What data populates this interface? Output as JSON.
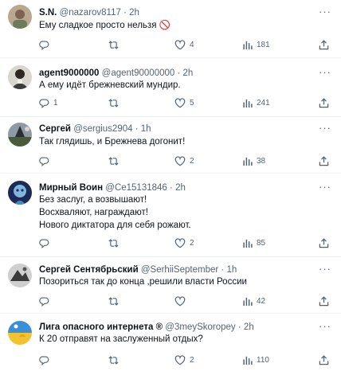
{
  "comments": [
    {
      "name": "S.N.",
      "handle": "@nazarov8117",
      "dot": "·",
      "time": "2h",
      "lines": [
        "Ему сладкое просто нельзя 🚫"
      ],
      "reply_count": "",
      "retweet_count": "",
      "like_count": "4",
      "view_count": "181"
    },
    {
      "name": "agent9000000",
      "handle": "@agent90000000",
      "dot": "·",
      "time": "2h",
      "lines": [
        "А ему идёт брежневский мундир."
      ],
      "reply_count": "1",
      "retweet_count": "",
      "like_count": "5",
      "view_count": "241"
    },
    {
      "name": "Сергей",
      "handle": "@sergius2904",
      "dot": "·",
      "time": "1h",
      "lines": [
        "Так глядишь, и Брежнева догонит!"
      ],
      "reply_count": "",
      "retweet_count": "",
      "like_count": "2",
      "view_count": "38"
    },
    {
      "name": "Мирный Воин",
      "handle": "@Ce15131846",
      "dot": "·",
      "time": "2h",
      "lines": [
        "Без заслуг, а возвышают!",
        "Восхваляют, награждают!",
        "Нового диктатора для себя рожают."
      ],
      "reply_count": "",
      "retweet_count": "",
      "like_count": "2",
      "view_count": "85"
    },
    {
      "name": "Сергей Сентябрьский",
      "handle": "@SerhiiSeptember",
      "dot": "·",
      "time": "1h",
      "lines": [
        "Позориться так до конца ,решили власти России"
      ],
      "reply_count": "",
      "retweet_count": "",
      "like_count": "",
      "view_count": "42"
    },
    {
      "name": "Лига опасного интернета ®",
      "handle": "@3meySkoropey",
      "dot": "·",
      "time": "2h",
      "lines": [
        "К 20 отправят на заслуженный отдых?"
      ],
      "reply_count": "",
      "retweet_count": "",
      "like_count": "2",
      "view_count": "110"
    }
  ],
  "icons": {
    "reply": "reply-icon",
    "retweet": "retweet-icon",
    "like": "heart-icon",
    "views": "views-bar-chart-icon",
    "share": "share-icon",
    "more": "more-dots-icon"
  },
  "colors": {
    "text": "#0f1419",
    "muted": "#536471",
    "divider": "#eff3f4",
    "prohibited": "#e0245e"
  }
}
